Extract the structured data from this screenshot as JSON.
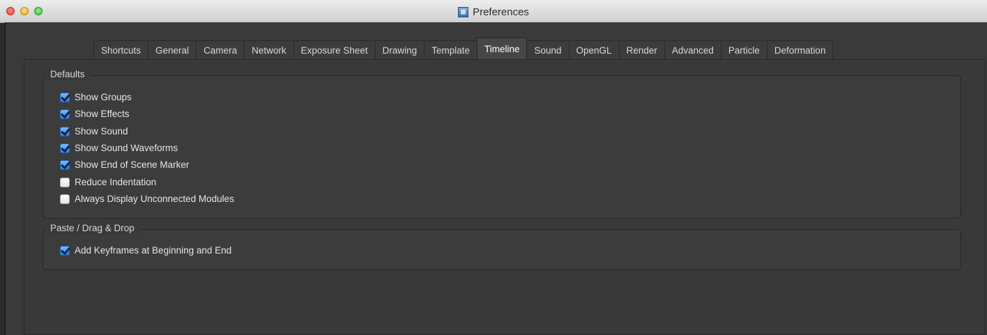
{
  "window": {
    "title": "Preferences",
    "app_icon_glyph": "⊞"
  },
  "tabs": [
    {
      "label": "Shortcuts",
      "active": false
    },
    {
      "label": "General",
      "active": false
    },
    {
      "label": "Camera",
      "active": false
    },
    {
      "label": "Network",
      "active": false
    },
    {
      "label": "Exposure Sheet",
      "active": false
    },
    {
      "label": "Drawing",
      "active": false
    },
    {
      "label": "Template",
      "active": false
    },
    {
      "label": "Timeline",
      "active": true
    },
    {
      "label": "Sound",
      "active": false
    },
    {
      "label": "OpenGL",
      "active": false
    },
    {
      "label": "Render",
      "active": false
    },
    {
      "label": "Advanced",
      "active": false
    },
    {
      "label": "Particle",
      "active": false
    },
    {
      "label": "Deformation",
      "active": false
    }
  ],
  "defaults": {
    "title": "Defaults",
    "options": [
      {
        "label": "Show Groups",
        "checked": true
      },
      {
        "label": "Show Effects",
        "checked": true
      },
      {
        "label": "Show Sound",
        "checked": true
      },
      {
        "label": "Show Sound Waveforms",
        "checked": true
      },
      {
        "label": "Show End of Scene Marker",
        "checked": true
      },
      {
        "label": "Reduce Indentation",
        "checked": false
      },
      {
        "label": "Always Display Unconnected Modules",
        "checked": false
      }
    ]
  },
  "paste_drag_drop": {
    "title": "Paste / Drag  & Drop",
    "options": [
      {
        "label": "Add Keyframes at Beginning and End",
        "checked": true
      }
    ]
  },
  "colors": {
    "accent": "#2f7ee6",
    "background": "#3a3a3a"
  }
}
